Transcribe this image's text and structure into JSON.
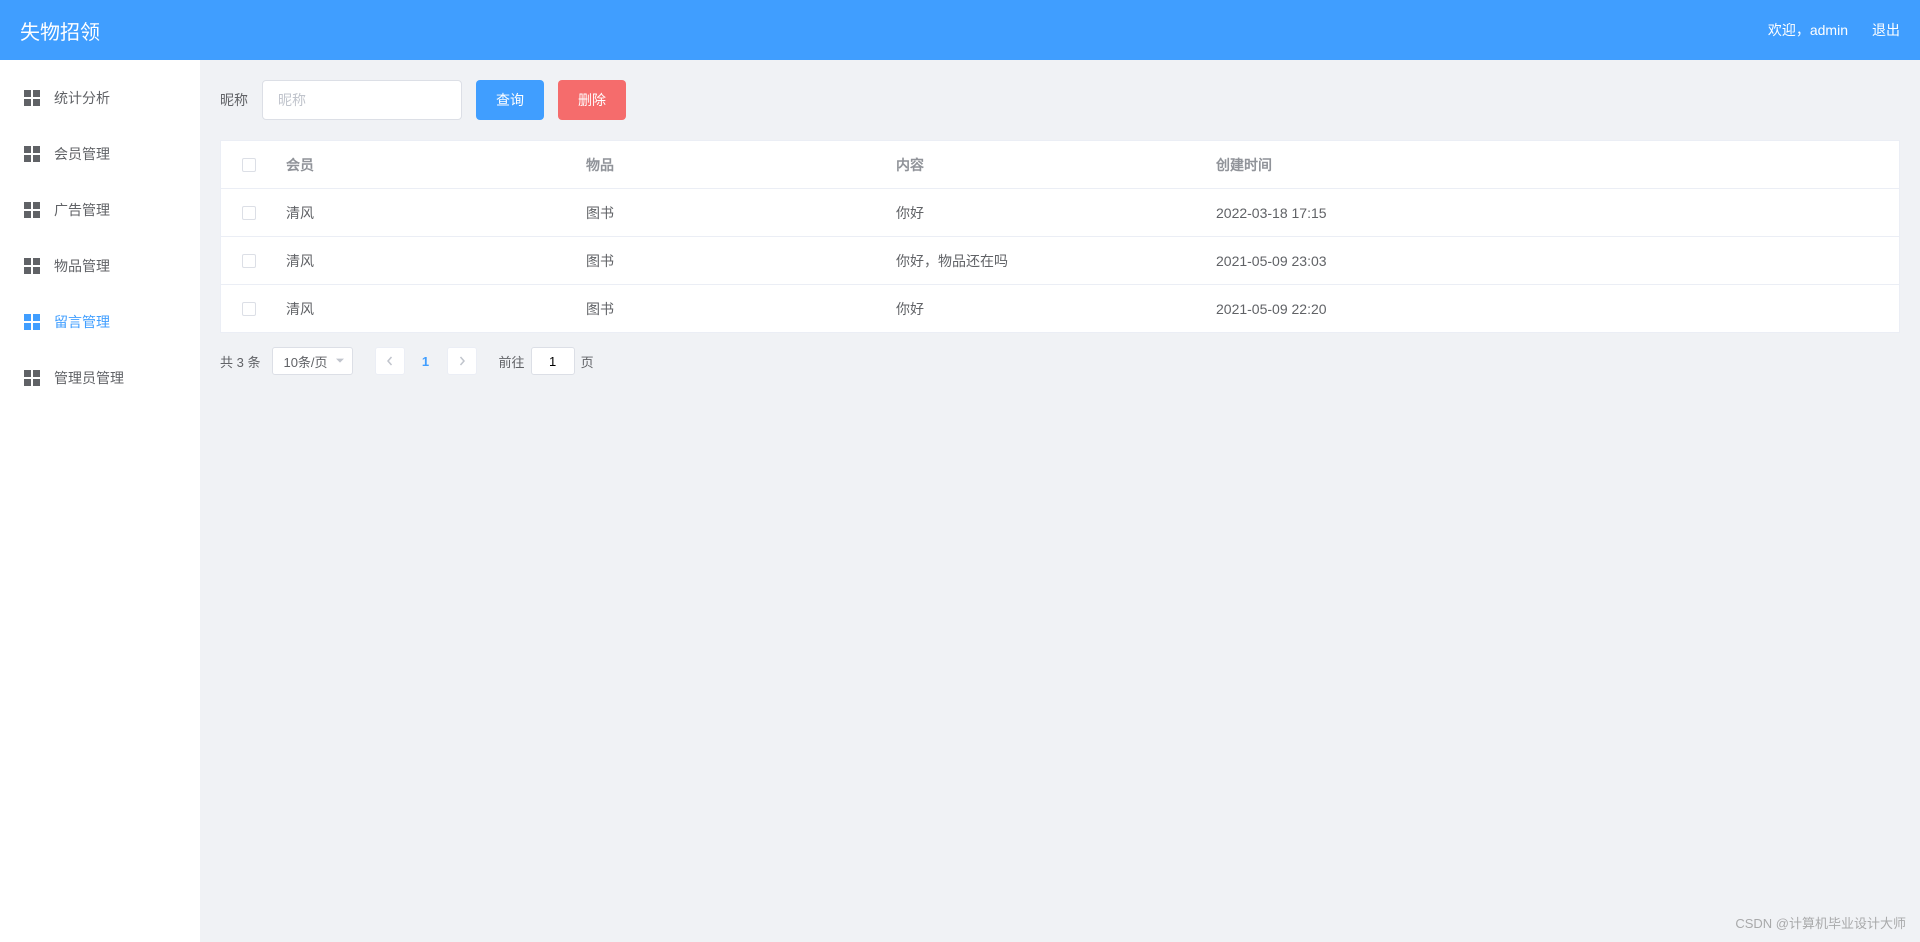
{
  "header": {
    "title": "失物招领",
    "welcome": "欢迎，admin",
    "logout": "退出"
  },
  "sidebar": {
    "items": [
      {
        "label": "统计分析"
      },
      {
        "label": "会员管理"
      },
      {
        "label": "广告管理"
      },
      {
        "label": "物品管理"
      },
      {
        "label": "留言管理"
      },
      {
        "label": "管理员管理"
      }
    ]
  },
  "toolbar": {
    "nickname_label": "昵称",
    "nickname_placeholder": "昵称",
    "search_label": "查询",
    "delete_label": "删除"
  },
  "table": {
    "headers": {
      "member": "会员",
      "item": "物品",
      "content": "内容",
      "createdAt": "创建时间"
    },
    "rows": [
      {
        "member": "清风",
        "item": "图书",
        "content": "你好",
        "createdAt": "2022-03-18 17:15"
      },
      {
        "member": "清风",
        "item": "图书",
        "content": "你好，物品还在吗",
        "createdAt": "2021-05-09 23:03"
      },
      {
        "member": "清风",
        "item": "图书",
        "content": "你好",
        "createdAt": "2021-05-09 22:20"
      }
    ]
  },
  "pagination": {
    "total_text": "共 3 条",
    "page_size_text": "10条/页",
    "current_page": "1",
    "jump_prefix": "前往",
    "jump_value": "1",
    "jump_suffix": "页"
  },
  "watermark": "CSDN @计算机毕业设计大师"
}
